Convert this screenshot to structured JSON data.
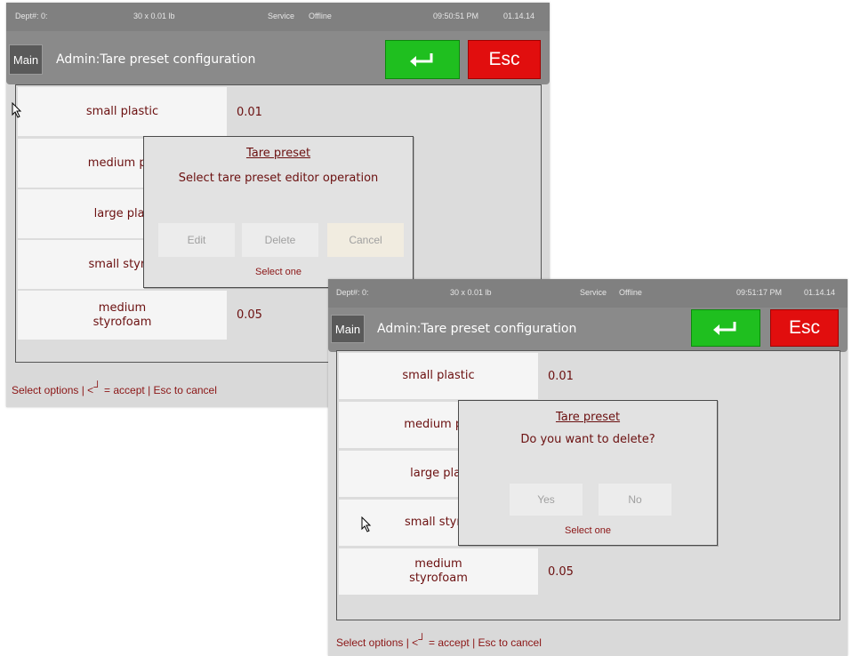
{
  "screens": [
    {
      "status": {
        "dept": "Dept#: 0:",
        "weight": "30 x 0.01 lb",
        "service": "Service",
        "offline": "Offline",
        "time": "09:50:51 PM",
        "date": "01.14.14"
      },
      "header": {
        "main_label": "Main",
        "title": "Admin:Tare preset configuration",
        "esc_label": "Esc"
      },
      "rows": [
        {
          "name": "small plastic",
          "value": "0.01"
        },
        {
          "name": "medium pla",
          "value": ""
        },
        {
          "name": "large plas",
          "value": ""
        },
        {
          "name": "small styrof",
          "value": ""
        },
        {
          "name": "medium\nstyrofoam",
          "value": "0.05"
        }
      ],
      "footer": {
        "prefix": "Select options | <",
        "suffix": " = accept | Esc to cancel"
      },
      "dialog": {
        "title": "Tare preset",
        "message": "Select tare preset editor operation",
        "buttons": [
          "Edit",
          "Delete",
          "Cancel"
        ],
        "hint": "Select one"
      }
    },
    {
      "status": {
        "dept": "Dept#: 0:",
        "weight": "30 x 0.01 lb",
        "service": "Service",
        "offline": "Offline",
        "time": "09:51:17 PM",
        "date": "01.14.14"
      },
      "header": {
        "main_label": "Main",
        "title": "Admin:Tare preset configuration",
        "esc_label": "Esc"
      },
      "rows": [
        {
          "name": "small plastic",
          "value": "0.01"
        },
        {
          "name": "medium pla",
          "value": ""
        },
        {
          "name": "large plas",
          "value": ""
        },
        {
          "name": "small styrof",
          "value": ""
        },
        {
          "name": "medium\nstyrofoam",
          "value": "0.05"
        }
      ],
      "footer": {
        "prefix": "Select options | <",
        "suffix": " = accept | Esc to cancel"
      },
      "dialog": {
        "title": "Tare preset",
        "message": "Do you want to delete?",
        "buttons": [
          "Yes",
          "No"
        ],
        "hint": "Select one"
      }
    }
  ],
  "icons": {
    "enter": "enter-arrow-icon",
    "cursor": "mouse-cursor-icon"
  },
  "colors": {
    "accept_green": "#1fbf1f",
    "esc_red": "#e10e0e",
    "text_maroon": "#6b1010",
    "status_bar": "#808080"
  }
}
